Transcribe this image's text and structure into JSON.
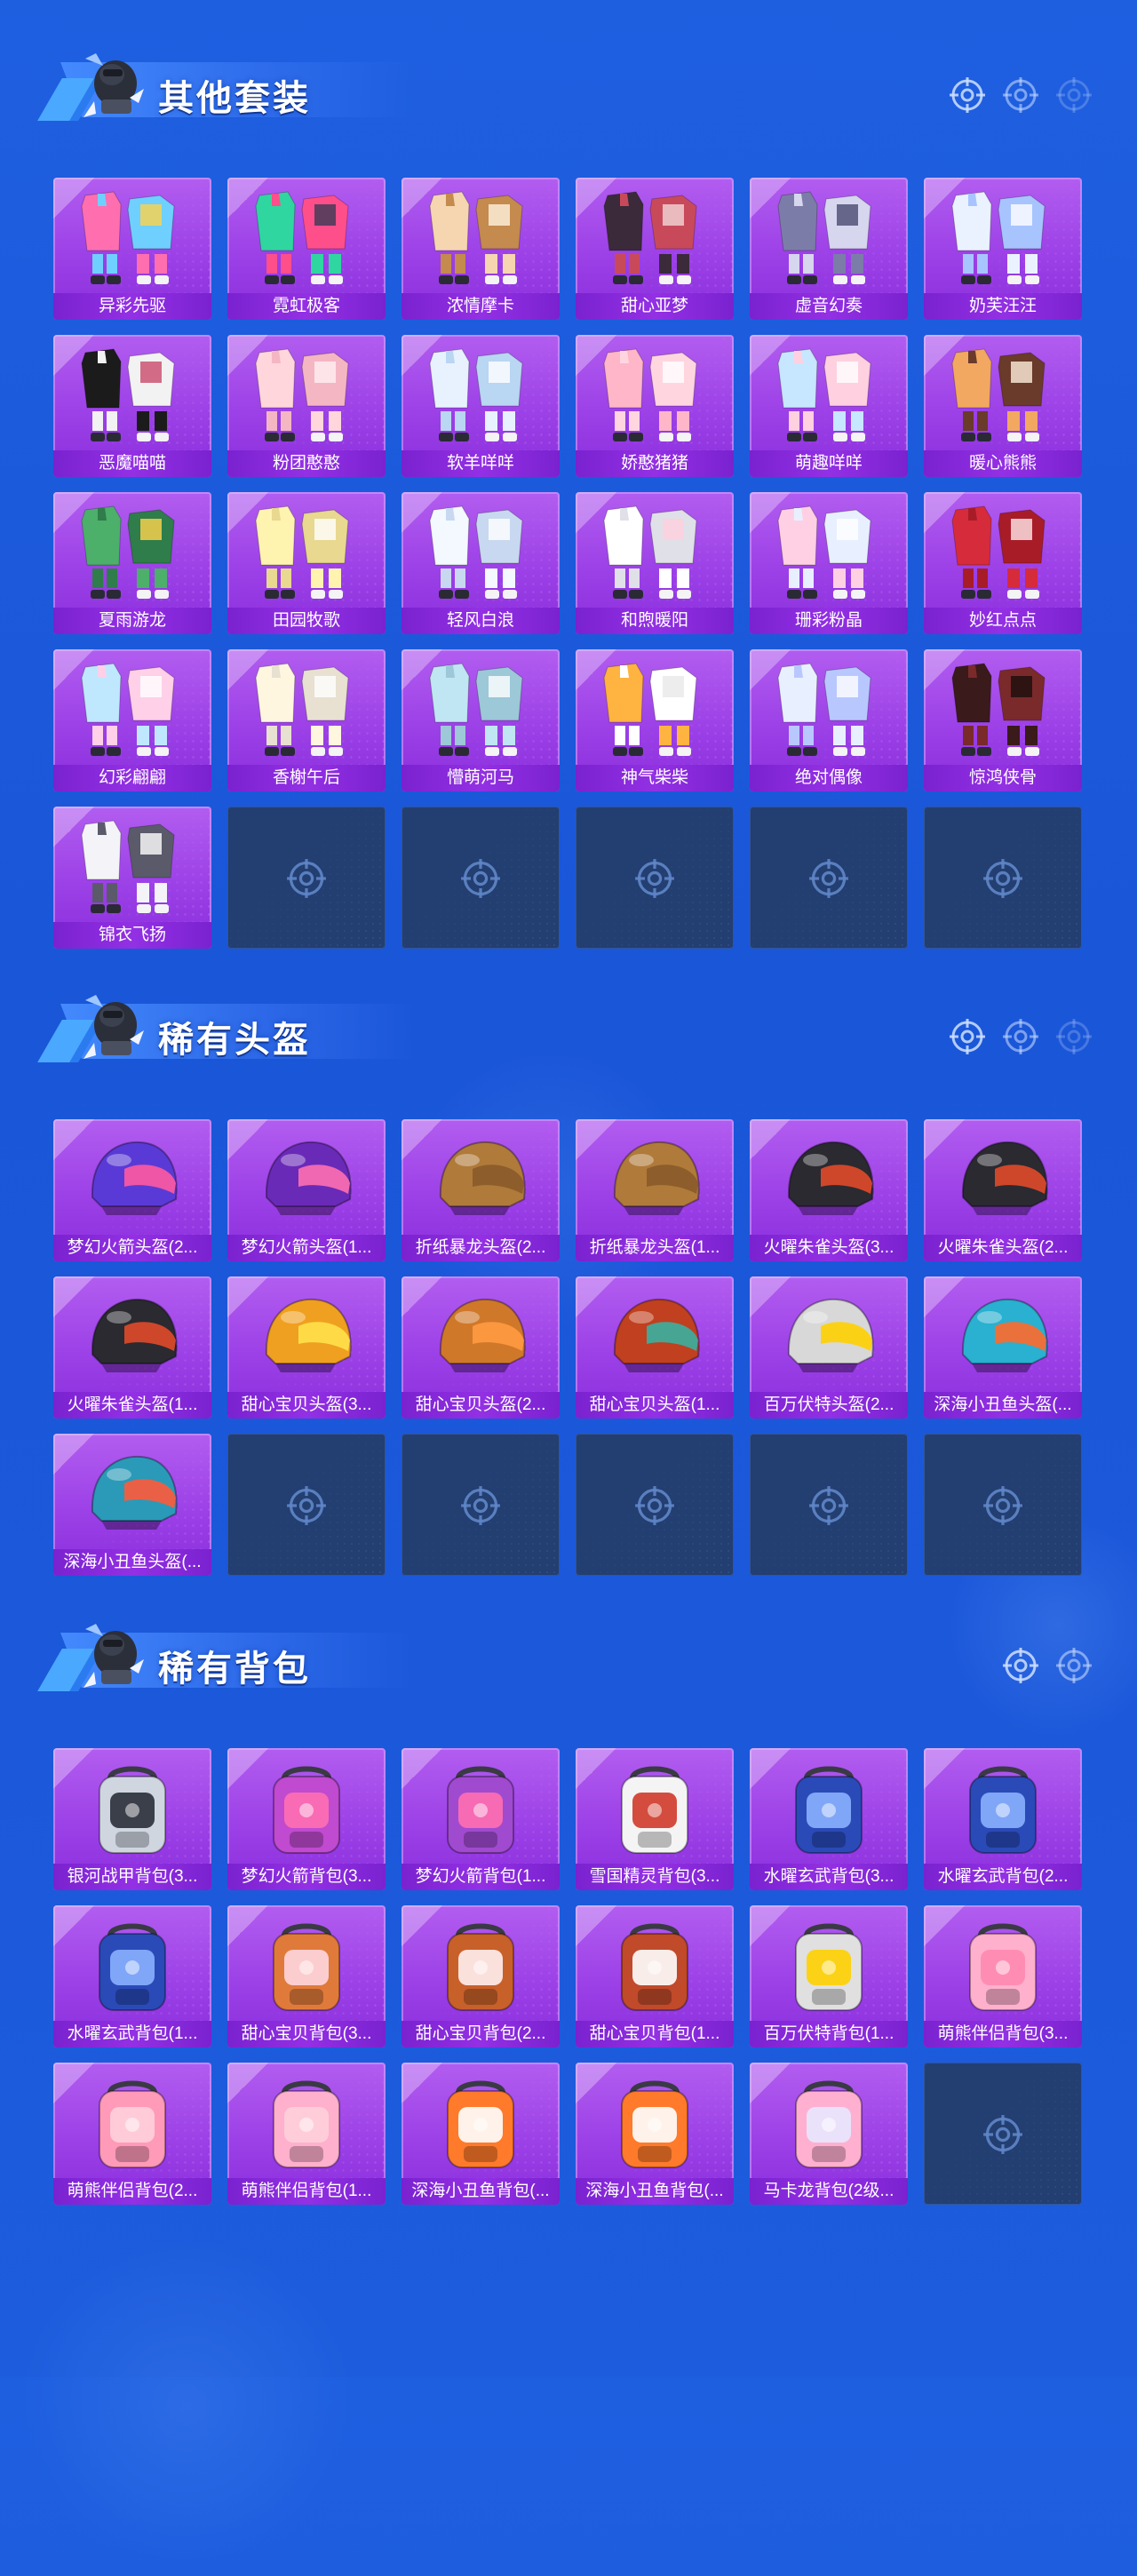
{
  "colors": {
    "background": "#1e5fe0",
    "card_purple": "#9a3ee6",
    "label_bar": "#7a22d0",
    "empty_slot": "#233e70",
    "title_text": "#ffffff"
  },
  "sections": [
    {
      "title": "其他套装",
      "icons": [
        "crosshair-icon",
        "crosshair-icon",
        "crosshair-icon"
      ],
      "items": [
        {
          "label": "异彩先驱",
          "art": "outfit"
        },
        {
          "label": "霓虹极客",
          "art": "outfit"
        },
        {
          "label": "浓情摩卡",
          "art": "outfit"
        },
        {
          "label": "甜心亚梦",
          "art": "outfit"
        },
        {
          "label": "虚音幻奏",
          "art": "outfit"
        },
        {
          "label": "奶芙汪汪",
          "art": "outfit"
        },
        {
          "label": "恶魔喵喵",
          "art": "outfit"
        },
        {
          "label": "粉团憨憨",
          "art": "outfit"
        },
        {
          "label": "软羊咩咩",
          "art": "outfit"
        },
        {
          "label": "娇憨猪猪",
          "art": "outfit"
        },
        {
          "label": "萌趣咩咩",
          "art": "outfit"
        },
        {
          "label": "暖心熊熊",
          "art": "outfit"
        },
        {
          "label": "夏雨游龙",
          "art": "outfit"
        },
        {
          "label": "田园牧歌",
          "art": "outfit"
        },
        {
          "label": "轻风白浪",
          "art": "outfit"
        },
        {
          "label": "和煦暖阳",
          "art": "outfit"
        },
        {
          "label": "珊彩粉晶",
          "art": "outfit"
        },
        {
          "label": "妙红点点",
          "art": "outfit"
        },
        {
          "label": "幻彩翩翩",
          "art": "outfit"
        },
        {
          "label": "香榭午后",
          "art": "outfit"
        },
        {
          "label": "懵萌河马",
          "art": "outfit"
        },
        {
          "label": "神气柴柴",
          "art": "outfit"
        },
        {
          "label": "绝对偶像",
          "art": "outfit"
        },
        {
          "label": "惊鸿侠骨",
          "art": "outfit"
        },
        {
          "label": "锦衣飞扬",
          "art": "outfit"
        }
      ],
      "empty_slots": 5
    },
    {
      "title": "稀有头盔",
      "icons": [
        "crosshair-icon",
        "crosshair-icon",
        "crosshair-icon"
      ],
      "items": [
        {
          "label": "梦幻火箭头盔(2...",
          "art": "helmet"
        },
        {
          "label": "梦幻火箭头盔(1...",
          "art": "helmet"
        },
        {
          "label": "折纸暴龙头盔(2...",
          "art": "helmet"
        },
        {
          "label": "折纸暴龙头盔(1...",
          "art": "helmet"
        },
        {
          "label": "火曜朱雀头盔(3...",
          "art": "helmet"
        },
        {
          "label": "火曜朱雀头盔(2...",
          "art": "helmet"
        },
        {
          "label": "火曜朱雀头盔(1...",
          "art": "helmet"
        },
        {
          "label": "甜心宝贝头盔(3...",
          "art": "helmet"
        },
        {
          "label": "甜心宝贝头盔(2...",
          "art": "helmet"
        },
        {
          "label": "甜心宝贝头盔(1...",
          "art": "helmet"
        },
        {
          "label": "百万伏特头盔(2...",
          "art": "helmet"
        },
        {
          "label": "深海小丑鱼头盔(...",
          "art": "helmet"
        },
        {
          "label": "深海小丑鱼头盔(...",
          "art": "helmet"
        }
      ],
      "empty_slots": 5
    },
    {
      "title": "稀有背包",
      "icons": [
        "crosshair-icon",
        "crosshair-icon"
      ],
      "items": [
        {
          "label": "银河战甲背包(3...",
          "art": "backpack"
        },
        {
          "label": "梦幻火箭背包(3...",
          "art": "backpack"
        },
        {
          "label": "梦幻火箭背包(1...",
          "art": "backpack"
        },
        {
          "label": "雪国精灵背包(3...",
          "art": "backpack"
        },
        {
          "label": "水曜玄武背包(3...",
          "art": "backpack"
        },
        {
          "label": "水曜玄武背包(2...",
          "art": "backpack"
        },
        {
          "label": "水曜玄武背包(1...",
          "art": "backpack"
        },
        {
          "label": "甜心宝贝背包(3...",
          "art": "backpack"
        },
        {
          "label": "甜心宝贝背包(2...",
          "art": "backpack"
        },
        {
          "label": "甜心宝贝背包(1...",
          "art": "backpack"
        },
        {
          "label": "百万伏特背包(1...",
          "art": "backpack"
        },
        {
          "label": "萌熊伴侣背包(3...",
          "art": "backpack"
        },
        {
          "label": "萌熊伴侣背包(2...",
          "art": "backpack"
        },
        {
          "label": "萌熊伴侣背包(1...",
          "art": "backpack"
        },
        {
          "label": "深海小丑鱼背包(...",
          "art": "backpack"
        },
        {
          "label": "深海小丑鱼背包(...",
          "art": "backpack"
        },
        {
          "label": "马卡龙背包(2级...",
          "art": "backpack"
        }
      ],
      "empty_slots": 1
    }
  ]
}
